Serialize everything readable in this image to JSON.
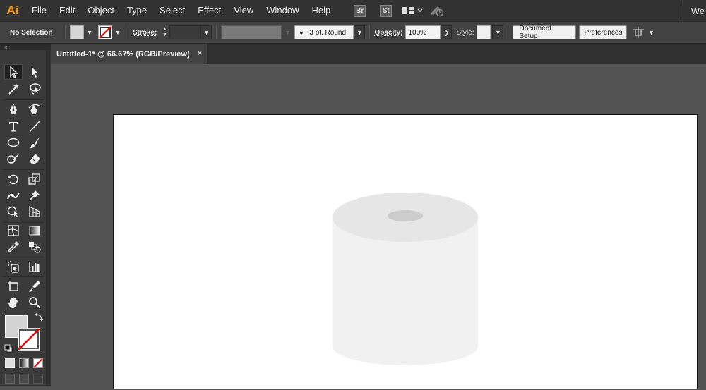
{
  "menubar": {
    "app_logo": "Ai",
    "items": [
      "File",
      "Edit",
      "Object",
      "Type",
      "Select",
      "Effect",
      "View",
      "Window",
      "Help"
    ],
    "bridge_label": "Br",
    "stock_label": "St",
    "workspace_label": "We"
  },
  "controlbar": {
    "selection_label": "No Selection",
    "stroke_label": "Stroke:",
    "brush_value": "3 pt. Round",
    "opacity_label": "Opacity:",
    "opacity_value": "100%",
    "style_label": "Style:",
    "document_setup_label": "Document Setup",
    "preferences_label": "Preferences"
  },
  "document": {
    "tab_title": "Untitled-1* @ 66.67% (RGB/Preview)",
    "close_glyph": "×"
  },
  "colors": {
    "fill": "#d3d3d3",
    "cylinder_body": "#f1f1f1",
    "cylinder_top": "#e6e6e6",
    "cylinder_hole": "#cccccc"
  }
}
